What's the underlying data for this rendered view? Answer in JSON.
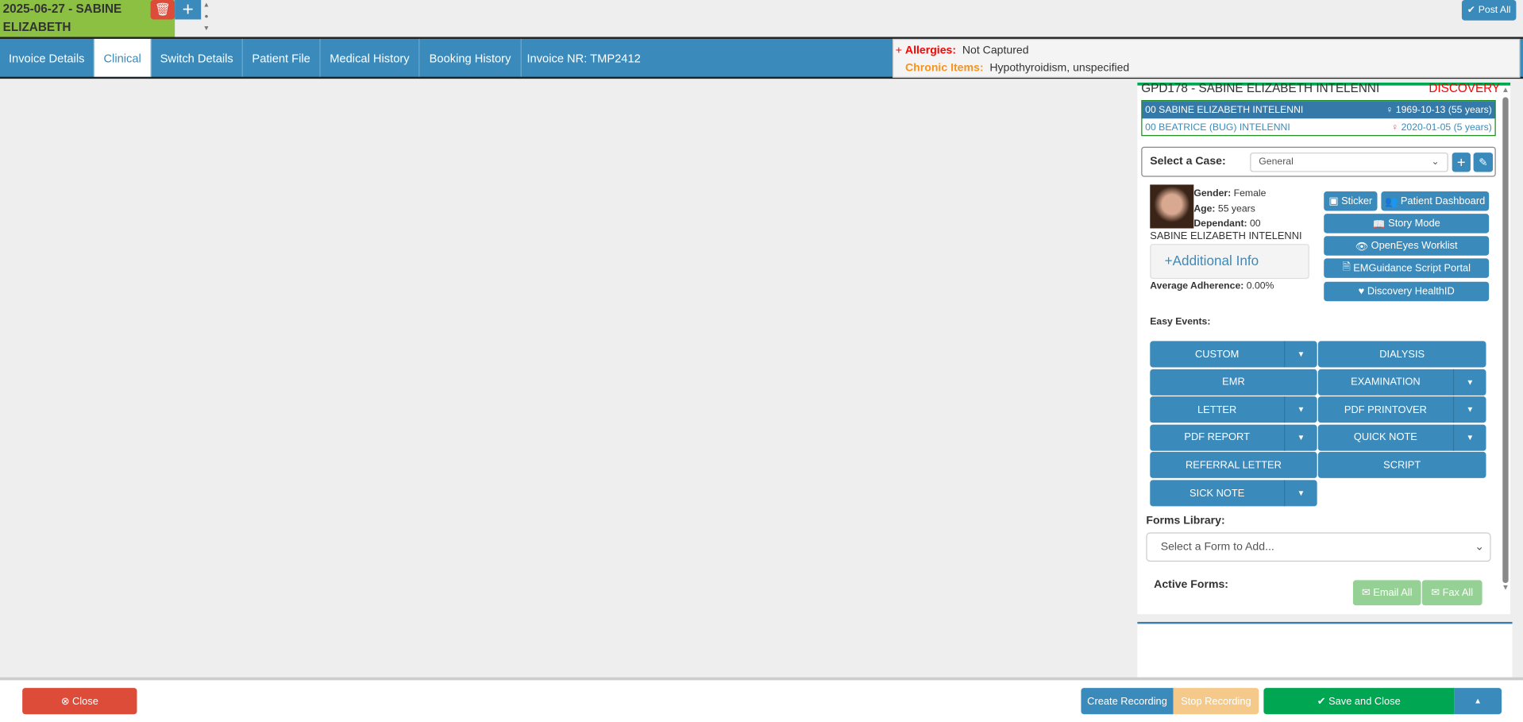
{
  "top": {
    "invoice_title": "2025-06-27 - SABINE ELIZABETH",
    "post_all": "Post All"
  },
  "tabs": [
    {
      "label": "Invoice Details"
    },
    {
      "label": "Clinical"
    },
    {
      "label": "Switch Details"
    },
    {
      "label": "Patient File"
    },
    {
      "label": "Medical History"
    },
    {
      "label": "Booking History"
    },
    {
      "label": "Invoice NR: TMP2412"
    }
  ],
  "alerts": {
    "allergies_label": "Allergies:",
    "allergies_value": "Not Captured",
    "chronic_label": "Chronic Items:",
    "chronic_value": "Hypothyroidism, unspecified",
    "colors": {
      "allergies": "#ff0000",
      "chronic": "#f7941d"
    }
  },
  "panel": {
    "header": "GPD178 - SABINE ELIZABETH INTELENNI",
    "scheme": "DISCOVERY",
    "members": [
      {
        "name": "00 SABINE ELIZABETH INTELENNI",
        "dob": "1969-10-13 (55 years)"
      },
      {
        "name": "00 BEATRICE (BUG) INTELENNI",
        "dob": "2020-01-05 (5 years)"
      }
    ],
    "case_label": "Select a Case:",
    "case_value": "General",
    "gender_label": "Gender:",
    "gender": "Female",
    "age_label": "Age:",
    "age": "55 years",
    "dependant_label": "Dependant:",
    "dependant": "00",
    "full_name": "SABINE ELIZABETH INTELENNI",
    "additional_info": "Additional Info",
    "adherence_label": "Average Adherence:",
    "adherence": "0.00%",
    "actions": {
      "sticker": "Sticker",
      "dashboard": "Patient Dashboard",
      "story": "Story Mode",
      "openeyes": "OpenEyes Worklist",
      "emguidance": "EMGuidance Script Portal",
      "healthid": "Discovery HealthID"
    },
    "easy_events_label": "Easy Events:",
    "events": [
      {
        "label": "CUSTOM"
      },
      {
        "label": "DIALYSIS"
      },
      {
        "label": "EMR"
      },
      {
        "label": "EXAMINATION"
      },
      {
        "label": "LETTER"
      },
      {
        "label": "PDF PRINTOVER"
      },
      {
        "label": "PDF REPORT"
      },
      {
        "label": "QUICK NOTE"
      },
      {
        "label": "REFERRAL LETTER"
      },
      {
        "label": "SCRIPT"
      },
      {
        "label": "SICK NOTE"
      }
    ],
    "forms_label": "Forms Library:",
    "forms_placeholder": "Select a Form to Add...",
    "active_forms": "Active Forms:",
    "email_all": "Email All",
    "fax_all": "Fax All"
  },
  "bottom": {
    "close": "Close",
    "create_recording": "Create Recording",
    "stop_recording": "Stop Recording",
    "save_close": "Save and Close"
  }
}
